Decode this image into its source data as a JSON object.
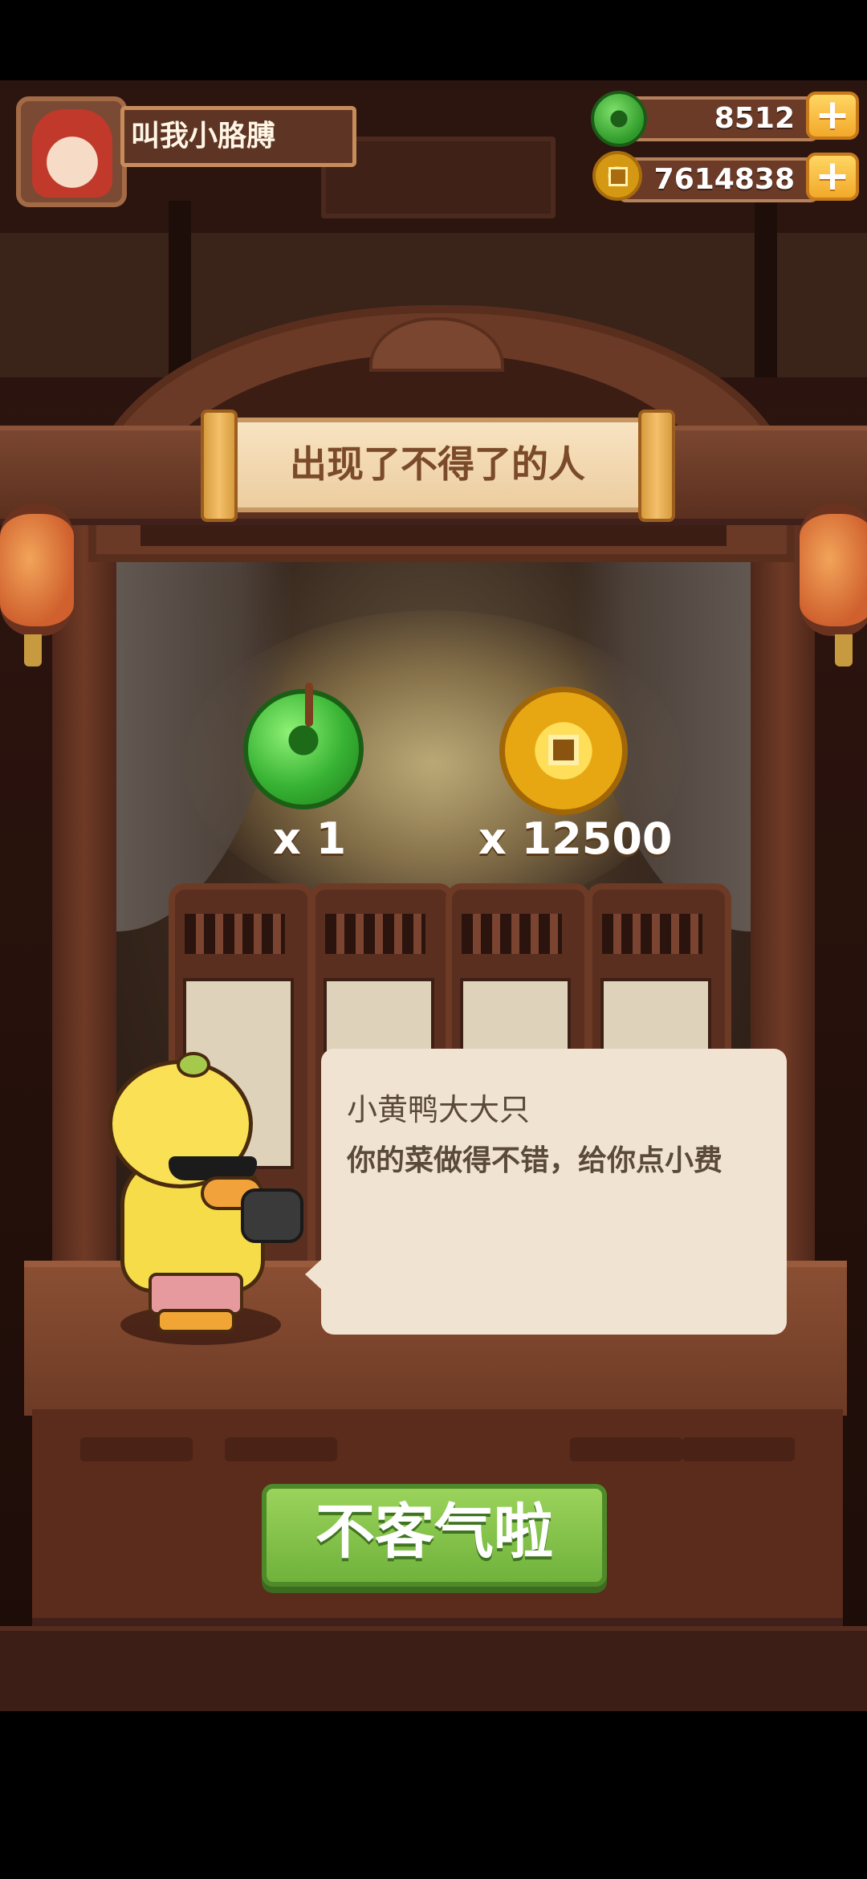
{
  "player": {
    "name": "叫我小胳膊"
  },
  "currencies": {
    "jade": {
      "icon": "jade-icon",
      "value": "8512"
    },
    "coin": {
      "icon": "coin-icon",
      "value": "7614838"
    }
  },
  "event": {
    "title": "出现了不得了的人",
    "rewards": [
      {
        "icon": "jade-icon",
        "amount_label": "x 1"
      },
      {
        "icon": "coin-icon",
        "amount_label": "x 12500"
      }
    ],
    "speaker": "小黄鸭大大只",
    "message": "你的菜做得不错，给你点小费",
    "confirm_label": "不客气啦"
  },
  "colors": {
    "button_green": "#7cc04a",
    "scroll_parchment": "#f3dbb4",
    "wood_brown": "#6a3a26",
    "bubble_bg": "#f1e3d2"
  }
}
